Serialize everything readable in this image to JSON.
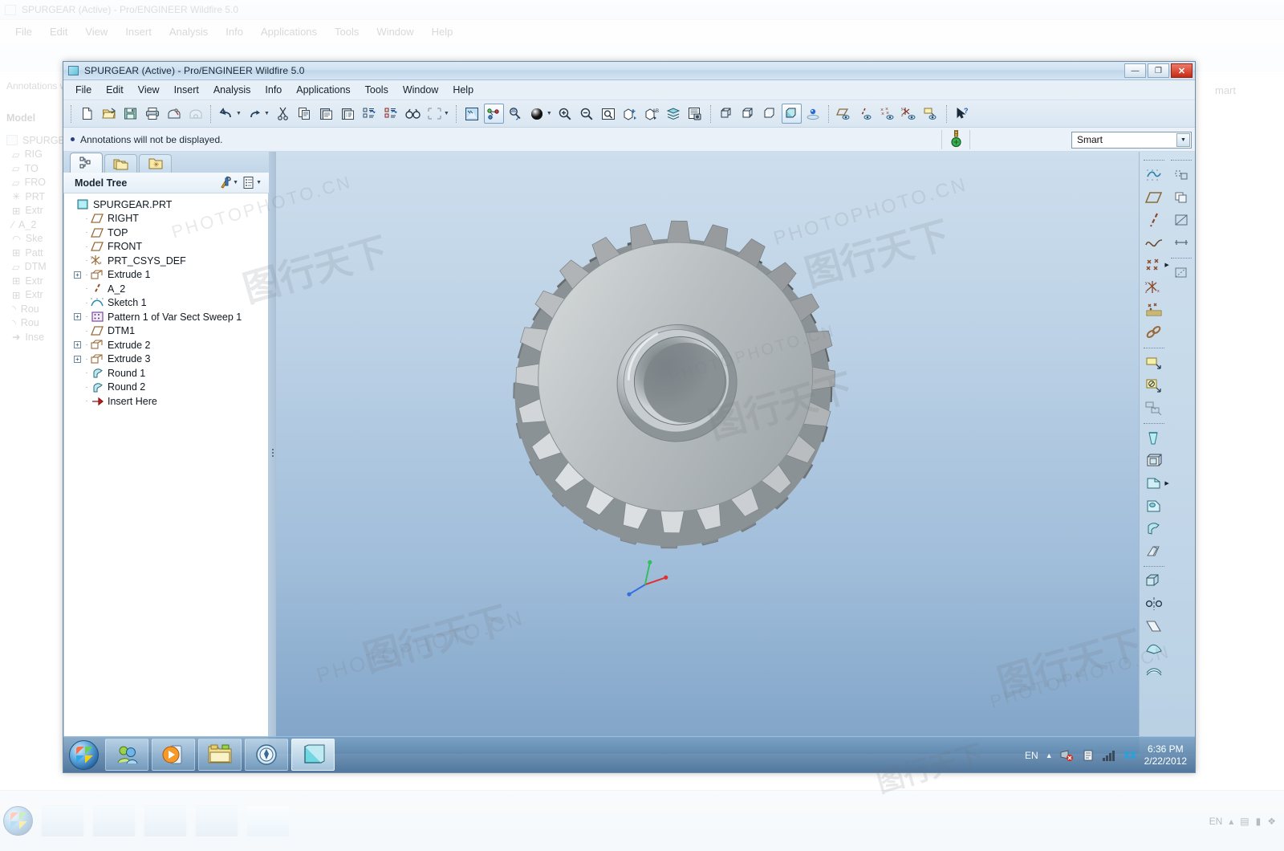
{
  "background_app": {
    "title": "SPURGEAR (Active) - Pro/ENGINEER Wildfire 5.0",
    "menu": [
      "File",
      "Edit",
      "View",
      "Insert",
      "Analysis",
      "Info",
      "Applications",
      "Tools",
      "Window",
      "Help"
    ],
    "message": "Annotations will not be displayed.",
    "panel_title": "Model",
    "smart_label": "mart",
    "tree": [
      "SPURGE",
      "RIG",
      "TO",
      "FRO",
      "PRT",
      "Extr",
      "A_2",
      "Ske",
      "Patt",
      "DTM",
      "Extr",
      "Extr",
      "Rou",
      "Rou",
      "Inse"
    ]
  },
  "window": {
    "title": "SPURGEAR (Active) - Pro/ENGINEER Wildfire 5.0",
    "icon": "part-icon",
    "buttons": {
      "minimize": "minimize-button",
      "maximize": "maximize-button",
      "close": "close-button",
      "minimize_glyph": "—",
      "maximize_glyph": "❐",
      "close_glyph": "✕"
    }
  },
  "menu": {
    "items": [
      {
        "label": "File",
        "name": "menu-file"
      },
      {
        "label": "Edit",
        "name": "menu-edit"
      },
      {
        "label": "View",
        "name": "menu-view"
      },
      {
        "label": "Insert",
        "name": "menu-insert"
      },
      {
        "label": "Analysis",
        "name": "menu-analysis"
      },
      {
        "label": "Info",
        "name": "menu-info"
      },
      {
        "label": "Applications",
        "name": "menu-applications"
      },
      {
        "label": "Tools",
        "name": "menu-tools"
      },
      {
        "label": "Window",
        "name": "menu-window"
      },
      {
        "label": "Help",
        "name": "menu-help"
      }
    ]
  },
  "toolbar": {
    "groups": [
      [
        "new-file-icon",
        "open-file-icon",
        "save-icon",
        "print-icon",
        "send-mail-icon",
        "send-link-icon"
      ],
      [
        "undo-icon",
        "redo-icon",
        "cut-icon",
        "copy-icon",
        "paste-icon",
        "paste-special-icon",
        "regenerate-icon",
        "regenerate-manual-icon",
        "find-icon",
        "select-box-icon"
      ],
      [
        "layers-display-icon",
        "datum-display-icon",
        "refit-icon",
        "shading-icon",
        "zoom-in-icon",
        "zoom-out-icon",
        "repaint-icon",
        "view-manager-icon",
        "annotation-icon",
        "layer-icon",
        "model-player-icon"
      ],
      [
        "display-wireframe-icon",
        "display-hidden-line-icon",
        "display-no-hidden-icon",
        "display-shading-icon",
        "spin-center-icon"
      ],
      [
        "datum-plane-display-icon",
        "datum-axis-display-icon",
        "datum-point-display-icon",
        "datum-csys-display-icon",
        "annotation-display-icon"
      ],
      [
        "help-context-icon"
      ]
    ]
  },
  "message_bar": {
    "text": "Annotations will not be displayed.",
    "status_icon": "traffic-light-icon"
  },
  "selection_filter": {
    "value": "Smart",
    "name": "selection-filter-select"
  },
  "navigator": {
    "tabs": [
      {
        "name": "tab-model-tree",
        "icon": "model-tree-icon",
        "selected": true
      },
      {
        "name": "tab-folder-browser",
        "icon": "folder-browser-icon",
        "selected": false
      },
      {
        "name": "tab-favorites",
        "icon": "favorites-folder-icon",
        "selected": false
      }
    ],
    "header": {
      "title": "Model Tree",
      "settings_icon": "tree-filters-icon",
      "display_icon": "tree-columns-icon",
      "caret": "▾"
    },
    "tree": [
      {
        "label": "SPURGEAR.PRT",
        "icon": "part-icon",
        "indent": 0,
        "expander": "none"
      },
      {
        "label": "RIGHT",
        "icon": "datum-plane-icon",
        "indent": 1,
        "expander": "none"
      },
      {
        "label": "TOP",
        "icon": "datum-plane-icon",
        "indent": 1,
        "expander": "none"
      },
      {
        "label": "FRONT",
        "icon": "datum-plane-icon",
        "indent": 1,
        "expander": "none"
      },
      {
        "label": "PRT_CSYS_DEF",
        "icon": "datum-csys-icon",
        "indent": 1,
        "expander": "none"
      },
      {
        "label": "Extrude 1",
        "icon": "extrude-icon",
        "indent": 1,
        "expander": "+"
      },
      {
        "label": "A_2",
        "icon": "datum-axis-icon",
        "indent": 1,
        "expander": "none"
      },
      {
        "label": "Sketch 1",
        "icon": "sketch-icon",
        "indent": 1,
        "expander": "none"
      },
      {
        "label": "Pattern 1 of Var Sect Sweep 1",
        "icon": "pattern-icon",
        "indent": 1,
        "expander": "+"
      },
      {
        "label": "DTM1",
        "icon": "datum-plane-icon",
        "indent": 1,
        "expander": "none"
      },
      {
        "label": "Extrude 2",
        "icon": "extrude-icon",
        "indent": 1,
        "expander": "+"
      },
      {
        "label": "Extrude 3",
        "icon": "extrude-icon",
        "indent": 1,
        "expander": "+"
      },
      {
        "label": "Round 1",
        "icon": "round-icon",
        "indent": 1,
        "expander": "none"
      },
      {
        "label": "Round 2",
        "icon": "round-icon",
        "indent": 1,
        "expander": "none"
      },
      {
        "label": "Insert Here",
        "icon": "insert-here-icon",
        "indent": 1,
        "expander": "none"
      }
    ]
  },
  "right_toolbar": {
    "column1": [
      "sketch-icon",
      "datum-plane-icon",
      "datum-axis-icon",
      "datum-curve-icon",
      "datum-point-icon",
      "datum-csys-icon",
      "datum-point-field-icon",
      "datum-reference-icon",
      "sep",
      "extrude-icon",
      "revolve-icon",
      "sweep-blend-icon",
      "sep2",
      "draft-icon",
      "shell-icon",
      "rib-icon",
      "round-icon",
      "chamfer-icon",
      "hole-icon",
      "sep3",
      "pattern-icon",
      "mirror-icon",
      "trim-icon",
      "merge-icon",
      "offset-icon"
    ],
    "column2": [
      "group-icon",
      "copy-paste-icon",
      "section-icon",
      "measure-icon"
    ]
  },
  "model": {
    "name": "spur-gear-3d-model",
    "teeth": 24,
    "csys_axes": [
      "x",
      "y",
      "z"
    ]
  },
  "taskbar": {
    "start": "windows-start-orb",
    "items": [
      {
        "name": "taskbar-item-messenger",
        "icon": "people-icon",
        "active": false
      },
      {
        "name": "taskbar-item-media-player",
        "icon": "media-player-icon",
        "active": false
      },
      {
        "name": "taskbar-item-explorer",
        "icon": "folder-icon",
        "active": false
      },
      {
        "name": "taskbar-item-browser",
        "icon": "compass-browser-icon",
        "active": false
      },
      {
        "name": "taskbar-item-proengineer",
        "icon": "part-icon",
        "active": true
      }
    ],
    "tray": {
      "language": "EN",
      "show_hidden": "▲",
      "icons": [
        "network-error-icon",
        "action-center-icon",
        "signal-bars-icon",
        "dropbox-icon"
      ],
      "time": "6:36 PM",
      "date": "2/22/2012"
    }
  },
  "watermarks": {
    "latin": "PHOTOPHOTO.CN",
    "cjk": "图行天下"
  }
}
